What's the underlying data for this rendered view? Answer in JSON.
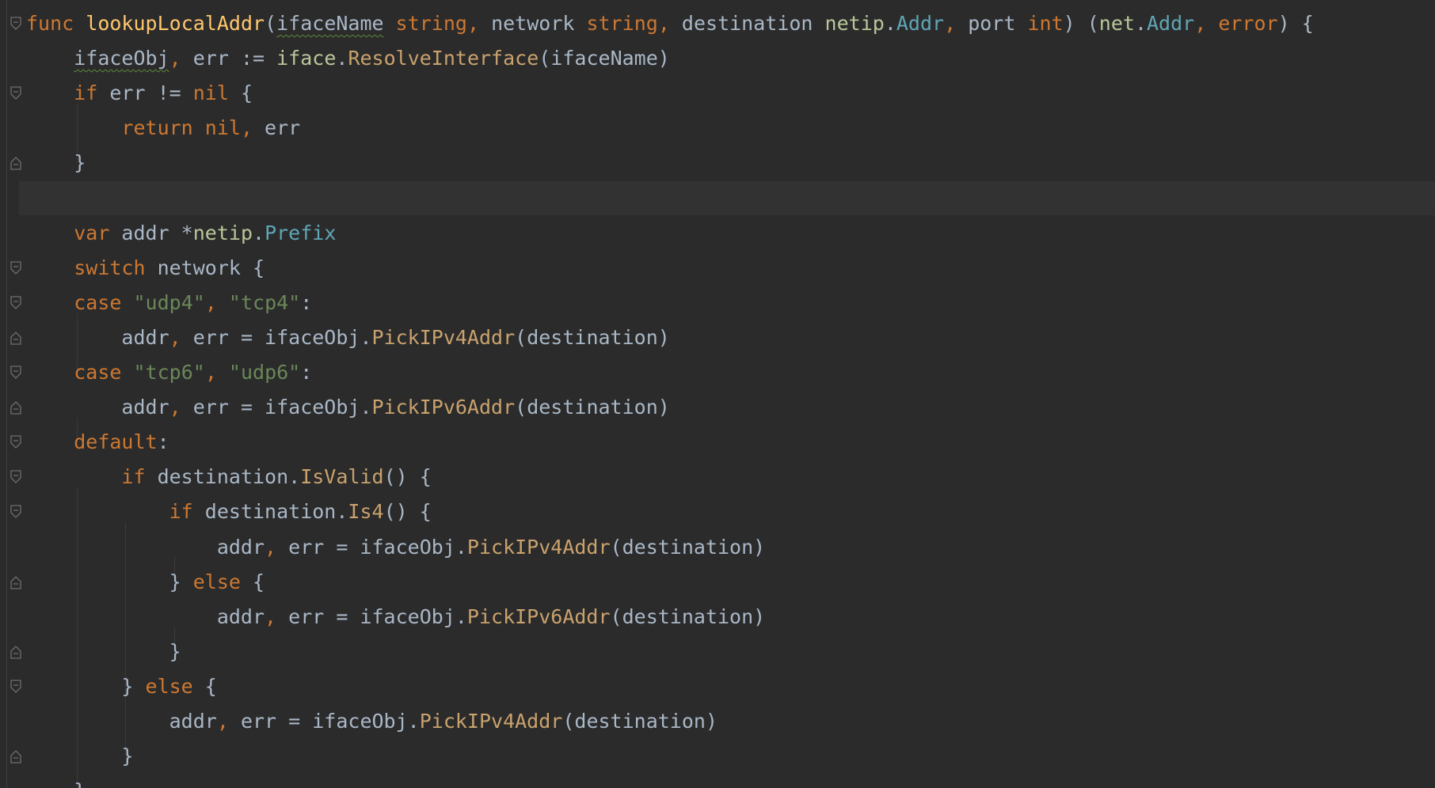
{
  "editor": {
    "language": "Go",
    "colors": {
      "background": "#2b2b2b",
      "current_line": "#323232",
      "keyword": "#cc7832",
      "function": "#ffc66d",
      "string": "#6a8759",
      "text": "#a9b7c6"
    },
    "lines": [
      {
        "tokens": [
          [
            "kw",
            "func"
          ],
          [
            "id",
            " "
          ],
          [
            "fn",
            "lookupLocalAddr"
          ],
          [
            "id",
            "("
          ],
          [
            "sq",
            "ifaceName"
          ],
          [
            "id",
            " "
          ],
          [
            "kw",
            "string"
          ],
          [
            "punct",
            ", "
          ],
          [
            "id",
            "network "
          ],
          [
            "kw",
            "string"
          ],
          [
            "punct",
            ", "
          ],
          [
            "id",
            "destination "
          ],
          [
            "pkg",
            "netip"
          ],
          [
            "id",
            "."
          ],
          [
            "typ2",
            "Addr"
          ],
          [
            "punct",
            ", "
          ],
          [
            "id",
            "port "
          ],
          [
            "kw",
            "int"
          ],
          [
            "id",
            ") ("
          ],
          [
            "pkg",
            "net"
          ],
          [
            "id",
            "."
          ],
          [
            "typ2",
            "Addr"
          ],
          [
            "punct",
            ", "
          ],
          [
            "kw",
            "error"
          ],
          [
            "id",
            ") {"
          ]
        ]
      },
      {
        "tokens": [
          [
            "id",
            "    "
          ],
          [
            "sq",
            "ifaceObj"
          ],
          [
            "punct",
            ", "
          ],
          [
            "id",
            "err := "
          ],
          [
            "pkg",
            "iface"
          ],
          [
            "id",
            "."
          ],
          [
            "method",
            "ResolveInterface"
          ],
          [
            "id",
            "(ifaceName)"
          ]
        ]
      },
      {
        "tokens": [
          [
            "id",
            "    "
          ],
          [
            "kw",
            "if"
          ],
          [
            "id",
            " err != "
          ],
          [
            "kw",
            "nil"
          ],
          [
            "id",
            " {"
          ]
        ]
      },
      {
        "tokens": [
          [
            "id",
            "        "
          ],
          [
            "kw",
            "return nil"
          ],
          [
            "punct",
            ", "
          ],
          [
            "id",
            "err"
          ]
        ]
      },
      {
        "tokens": [
          [
            "id",
            "    }"
          ]
        ]
      },
      {
        "tokens": []
      },
      {
        "tokens": [
          [
            "id",
            "    "
          ],
          [
            "kw",
            "var"
          ],
          [
            "id",
            " addr *"
          ],
          [
            "pkg",
            "netip"
          ],
          [
            "id",
            "."
          ],
          [
            "typ2",
            "Prefix"
          ]
        ]
      },
      {
        "tokens": [
          [
            "id",
            "    "
          ],
          [
            "kw",
            "switch"
          ],
          [
            "id",
            " network {"
          ]
        ]
      },
      {
        "tokens": [
          [
            "id",
            "    "
          ],
          [
            "kw",
            "case"
          ],
          [
            "id",
            " "
          ],
          [
            "str",
            "\"udp4\""
          ],
          [
            "punct",
            ", "
          ],
          [
            "str",
            "\"tcp4\""
          ],
          [
            "id",
            ":"
          ]
        ]
      },
      {
        "tokens": [
          [
            "id",
            "        addr"
          ],
          [
            "punct",
            ", "
          ],
          [
            "id",
            "err = ifaceObj."
          ],
          [
            "method",
            "PickIPv4Addr"
          ],
          [
            "id",
            "(destination)"
          ]
        ]
      },
      {
        "tokens": [
          [
            "id",
            "    "
          ],
          [
            "kw",
            "case"
          ],
          [
            "id",
            " "
          ],
          [
            "str",
            "\"tcp6\""
          ],
          [
            "punct",
            ", "
          ],
          [
            "str",
            "\"udp6\""
          ],
          [
            "id",
            ":"
          ]
        ]
      },
      {
        "tokens": [
          [
            "id",
            "        addr"
          ],
          [
            "punct",
            ", "
          ],
          [
            "id",
            "err = ifaceObj."
          ],
          [
            "method",
            "PickIPv6Addr"
          ],
          [
            "id",
            "(destination)"
          ]
        ]
      },
      {
        "tokens": [
          [
            "id",
            "    "
          ],
          [
            "kw",
            "default"
          ],
          [
            "id",
            ":"
          ]
        ]
      },
      {
        "tokens": [
          [
            "id",
            "        "
          ],
          [
            "kw",
            "if"
          ],
          [
            "id",
            " destination."
          ],
          [
            "method",
            "IsValid"
          ],
          [
            "id",
            "() {"
          ]
        ]
      },
      {
        "tokens": [
          [
            "id",
            "            "
          ],
          [
            "kw",
            "if"
          ],
          [
            "id",
            " destination."
          ],
          [
            "method",
            "Is4"
          ],
          [
            "id",
            "() {"
          ]
        ]
      },
      {
        "tokens": [
          [
            "id",
            "                addr"
          ],
          [
            "punct",
            ", "
          ],
          [
            "id",
            "err = ifaceObj."
          ],
          [
            "method",
            "PickIPv4Addr"
          ],
          [
            "id",
            "(destination)"
          ]
        ]
      },
      {
        "tokens": [
          [
            "id",
            "            } "
          ],
          [
            "kw",
            "else"
          ],
          [
            "id",
            " {"
          ]
        ]
      },
      {
        "tokens": [
          [
            "id",
            "                addr"
          ],
          [
            "punct",
            ", "
          ],
          [
            "id",
            "err = ifaceObj."
          ],
          [
            "method",
            "PickIPv6Addr"
          ],
          [
            "id",
            "(destination)"
          ]
        ]
      },
      {
        "tokens": [
          [
            "id",
            "            }"
          ]
        ]
      },
      {
        "tokens": [
          [
            "id",
            "        } "
          ],
          [
            "kw",
            "else"
          ],
          [
            "id",
            " {"
          ]
        ]
      },
      {
        "tokens": [
          [
            "id",
            "            addr"
          ],
          [
            "punct",
            ", "
          ],
          [
            "id",
            "err = ifaceObj."
          ],
          [
            "method",
            "PickIPv4Addr"
          ],
          [
            "id",
            "(destination)"
          ]
        ]
      },
      {
        "tokens": [
          [
            "id",
            "        }"
          ]
        ]
      },
      {
        "tokens": [
          [
            "id",
            "    }"
          ]
        ]
      }
    ],
    "fold_icons": [
      {
        "line": 0,
        "kind": "open"
      },
      {
        "line": 2,
        "kind": "open"
      },
      {
        "line": 4,
        "kind": "close"
      },
      {
        "line": 7,
        "kind": "open"
      },
      {
        "line": 8,
        "kind": "open"
      },
      {
        "line": 9,
        "kind": "close"
      },
      {
        "line": 10,
        "kind": "open"
      },
      {
        "line": 11,
        "kind": "close"
      },
      {
        "line": 12,
        "kind": "open"
      },
      {
        "line": 13,
        "kind": "open"
      },
      {
        "line": 14,
        "kind": "open"
      },
      {
        "line": 16,
        "kind": "close"
      },
      {
        "line": 18,
        "kind": "close"
      },
      {
        "line": 19,
        "kind": "open"
      },
      {
        "line": 21,
        "kind": "close"
      }
    ]
  }
}
